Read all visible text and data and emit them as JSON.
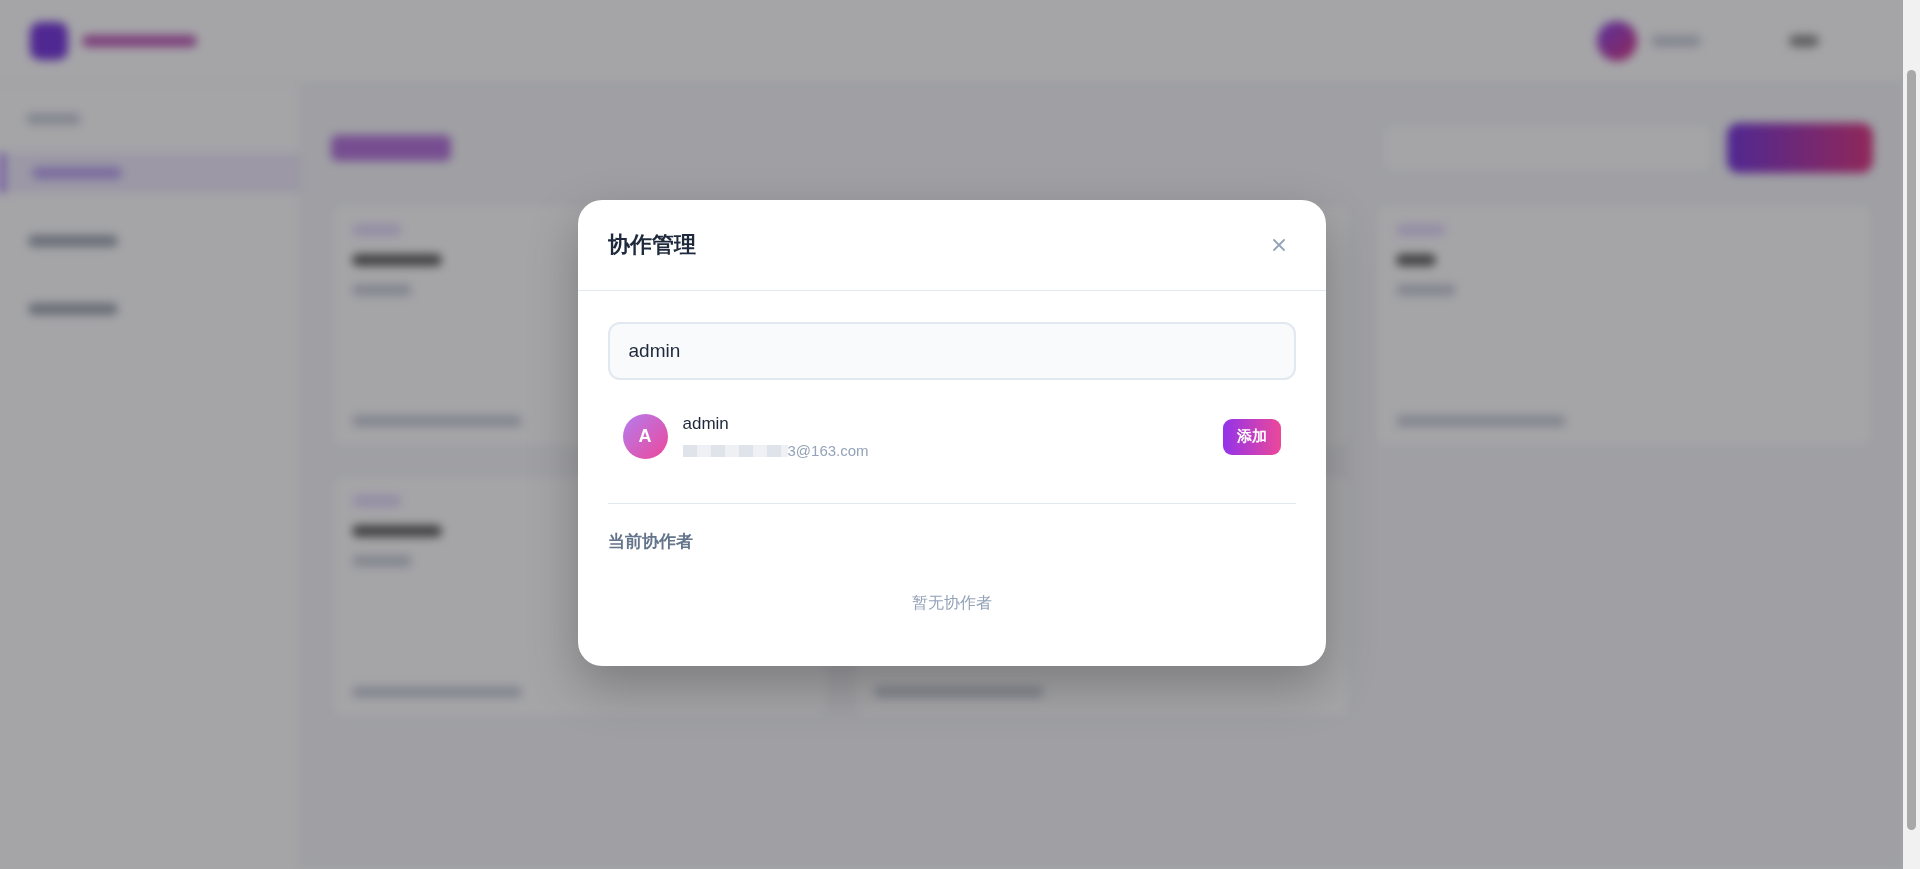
{
  "dialog": {
    "title": "协作管理",
    "search": {
      "value": "admin"
    },
    "results": [
      {
        "avatar": "A",
        "name": "admin",
        "email": "3@163.com",
        "email_redacted": true,
        "action": "添加"
      }
    ],
    "section_title": "当前协作者",
    "empty_text": "暂无协作者"
  }
}
